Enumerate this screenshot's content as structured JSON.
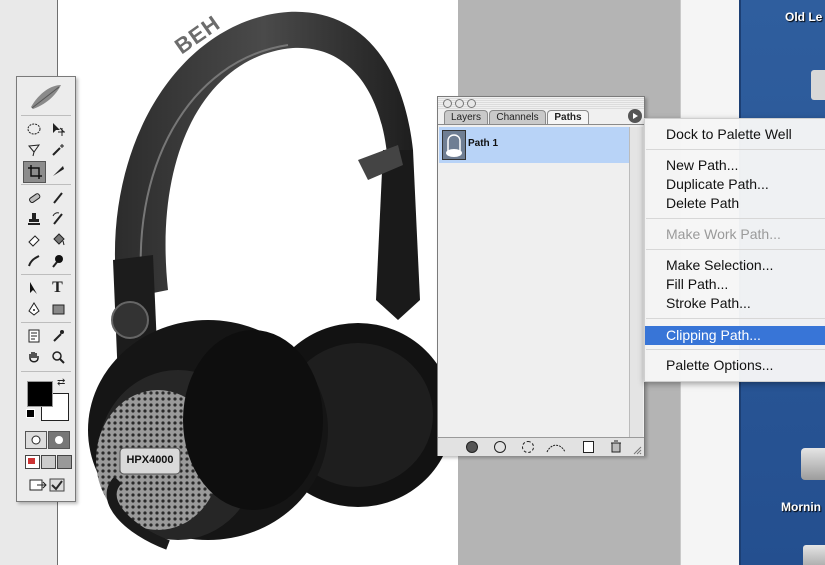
{
  "desktop": {
    "icons": [
      {
        "label": "Old Le"
      },
      {
        "label": "Mornin"
      }
    ]
  },
  "tools_palette": {
    "logo": "feather-icon",
    "tools": [
      "marquee-tool",
      "move-tool",
      "lasso-tool",
      "magic-wand-tool",
      "crop-tool",
      "slice-tool",
      "healing-brush-tool",
      "brush-tool",
      "clone-stamp-tool",
      "history-brush-tool",
      "eraser-tool",
      "paint-bucket-tool",
      "smudge-tool",
      "dodge-tool",
      "path-selection-tool",
      "type-tool",
      "pen-tool",
      "rectangle-tool",
      "notes-tool",
      "eyedropper-tool",
      "hand-tool",
      "zoom-tool"
    ],
    "type_label": "T",
    "colors": {
      "foreground": "#000000",
      "background": "#ffffff"
    }
  },
  "paths_palette": {
    "tabs": [
      {
        "label": "Layers"
      },
      {
        "label": "Channels"
      },
      {
        "label": "Paths"
      }
    ],
    "active_tab": "Paths",
    "items": [
      {
        "label": "Path 1",
        "selected": true
      }
    ],
    "footer_icons": [
      "fill-path-icon",
      "stroke-path-icon",
      "load-selection-icon",
      "make-work-path-icon",
      "new-path-icon",
      "delete-path-icon"
    ]
  },
  "menu": {
    "items": [
      {
        "label": "Dock to Palette Well",
        "state": "normal"
      },
      {
        "label": "New Path...",
        "state": "normal"
      },
      {
        "label": "Duplicate Path...",
        "state": "normal"
      },
      {
        "label": "Delete Path",
        "state": "normal"
      },
      {
        "label": "Make Work Path...",
        "state": "disabled"
      },
      {
        "label": "Make Selection...",
        "state": "normal"
      },
      {
        "label": "Fill Path...",
        "state": "normal"
      },
      {
        "label": "Stroke Path...",
        "state": "normal"
      },
      {
        "label": "Clipping Path...",
        "state": "highlighted"
      },
      {
        "label": "Palette Options...",
        "state": "normal"
      }
    ]
  },
  "artwork": {
    "headband_text": "BEH",
    "model_badge": "HPX4000"
  },
  "colors": {
    "highlight": "#3875d7",
    "path_row": "#b8d3f7",
    "desktop": "#2f5e9e"
  }
}
